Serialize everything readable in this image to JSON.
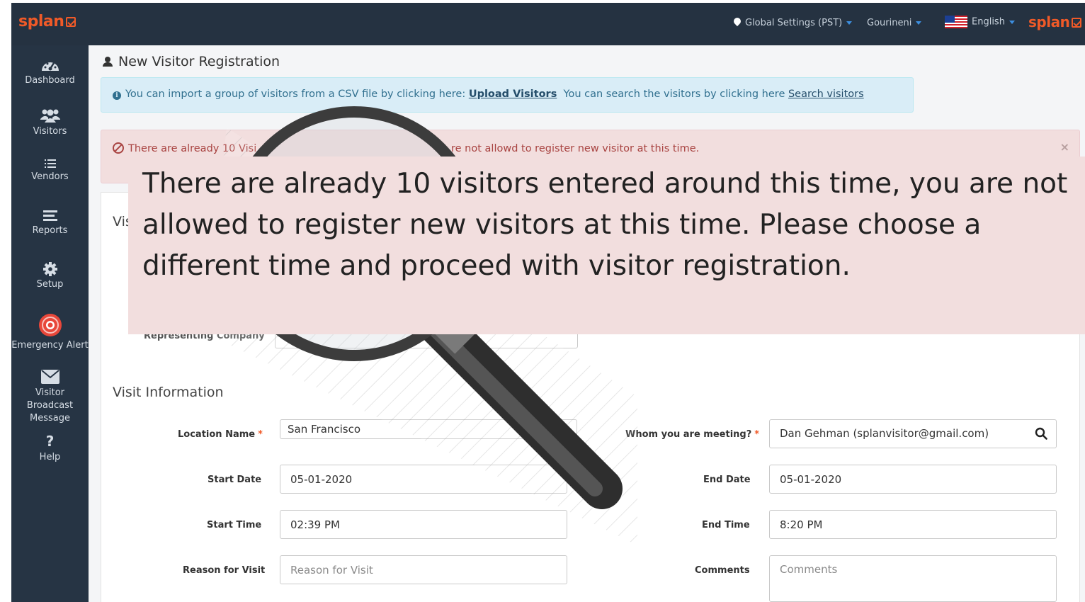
{
  "brand": {
    "logo_text": "splan",
    "brand_color": "#f05a28"
  },
  "topbar": {
    "settings_label": "Global Settings (PST)",
    "user_label": "Gourineni",
    "language_label": "English",
    "logo_right": "splan"
  },
  "sidebar": {
    "items": [
      {
        "label": "Dashboard",
        "icon": "dashboard-icon"
      },
      {
        "label": "Visitors",
        "icon": "visitors-icon"
      },
      {
        "label": "Vendors",
        "icon": "list-icon"
      },
      {
        "label": "Reports",
        "icon": "reports-icon"
      },
      {
        "label": "Setup",
        "icon": "gear-icon"
      },
      {
        "label": "Emergency Alert",
        "icon": "alert-icon"
      },
      {
        "label": "Visitor Broadcast",
        "label2": "Message",
        "icon": "envelope-icon"
      },
      {
        "label": "Help",
        "icon": "question-icon"
      }
    ]
  },
  "page": {
    "title": "New Visitor Registration",
    "info": {
      "text1": "You can import a group of visitors from a CSV file by clicking here:",
      "link1": "Upload Visitors",
      "text2": "You can search the visitors by clicking here",
      "link2": "Search visitors"
    },
    "error": {
      "text_left": "There are already 10 Visi",
      "text_right": "re not allowd to register new visitor at this time.",
      "close": "×"
    },
    "visitor_section_partial": "Vis",
    "representing_company_partial": "Representing Company",
    "visit_info": {
      "title": "Visit Information",
      "location_label": "Location Name",
      "location_value": "San Francisco",
      "meeting_label": "Whom you are meeting?",
      "meeting_value": "Dan Gehman (splanvisitor@gmail.com)",
      "start_date_label": "Start Date",
      "start_date_value": "05-01-2020",
      "end_date_label": "End Date",
      "end_date_value": "05-01-2020",
      "start_time_label": "Start Time",
      "start_time_value": "02:39 PM",
      "end_time_label": "End Time",
      "end_time_value": "8:20 PM",
      "reason_label": "Reason for Visit",
      "reason_placeholder": "Reason for Visit",
      "comments_label": "Comments",
      "comments_placeholder": "Comments",
      "required_mark": "*"
    }
  },
  "callout": {
    "line1": "There are already 10 visitors entered around this time, you are not",
    "line2": "allowed to register new visitors at this time. Please choose a",
    "line3": "different time and proceed with visitor registration."
  }
}
